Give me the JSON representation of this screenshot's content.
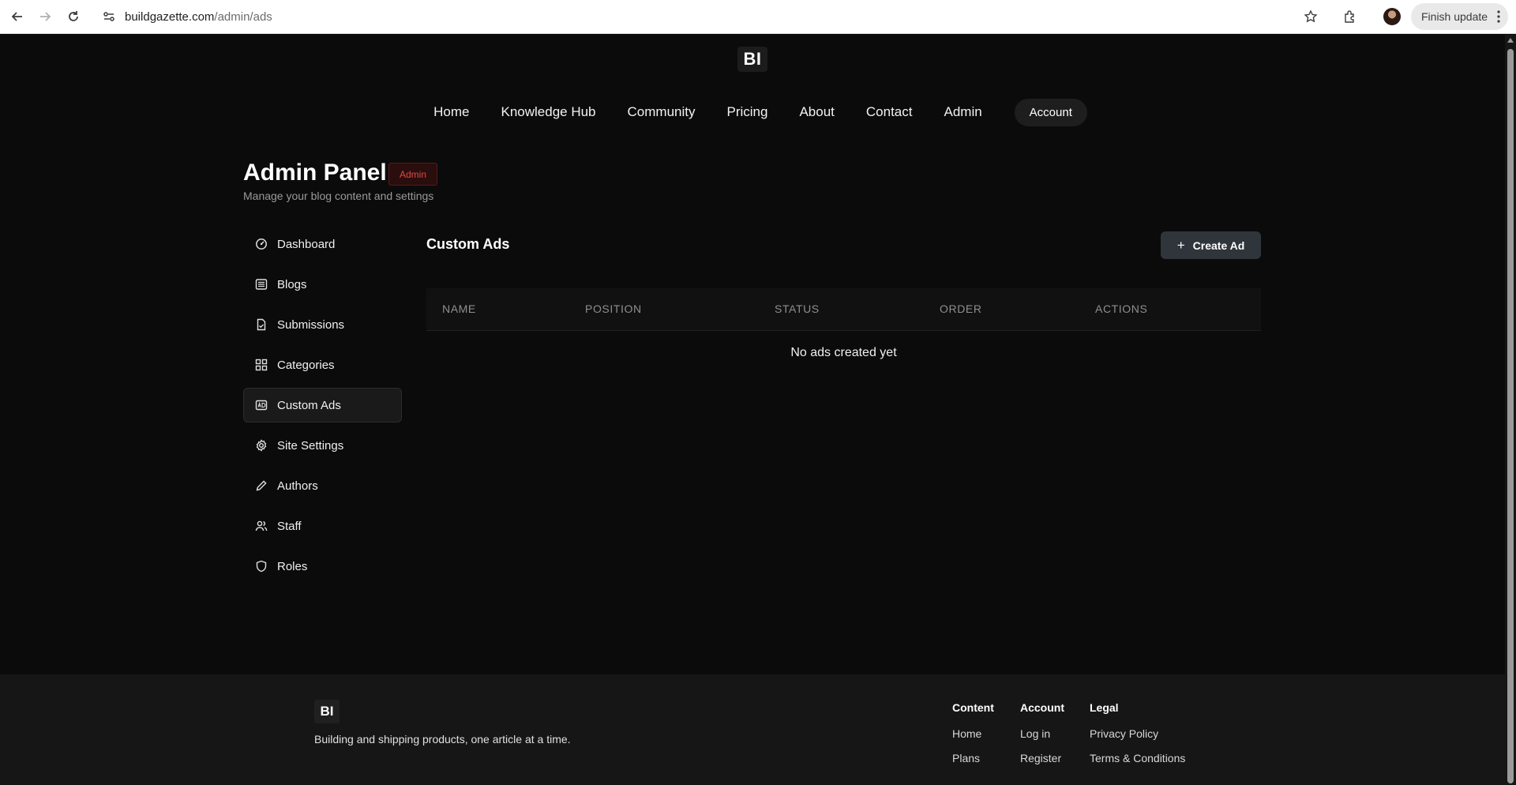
{
  "browser": {
    "url_host": "buildgazette.com",
    "url_path": "/admin/ads",
    "update_label": "Finish update"
  },
  "site": {
    "logo_text": "BI",
    "nav": [
      "Home",
      "Knowledge Hub",
      "Community",
      "Pricing",
      "About",
      "Contact",
      "Admin"
    ],
    "account_label": "Account"
  },
  "admin": {
    "title": "Admin Panel",
    "badge": "Admin",
    "subtitle": "Manage your blog content and settings"
  },
  "sidebar": {
    "items": [
      {
        "label": "Dashboard",
        "icon": "dashboard-icon",
        "active": false
      },
      {
        "label": "Blogs",
        "icon": "list-icon",
        "active": false
      },
      {
        "label": "Submissions",
        "icon": "document-check-icon",
        "active": false
      },
      {
        "label": "Categories",
        "icon": "grid-icon",
        "active": false
      },
      {
        "label": "Custom Ads",
        "icon": "ad-icon",
        "active": true
      },
      {
        "label": "Site Settings",
        "icon": "gear-icon",
        "active": false
      },
      {
        "label": "Authors",
        "icon": "pencil-icon",
        "active": false
      },
      {
        "label": "Staff",
        "icon": "users-icon",
        "active": false
      },
      {
        "label": "Roles",
        "icon": "shield-icon",
        "active": false
      }
    ]
  },
  "main": {
    "section_title": "Custom Ads",
    "create_label": "Create Ad",
    "columns": [
      "NAME",
      "POSITION",
      "STATUS",
      "ORDER",
      "ACTIONS"
    ],
    "empty_message": "No ads created yet"
  },
  "footer": {
    "logo_text": "BI",
    "tagline": "Building and shipping products, one article at a time.",
    "columns": [
      {
        "heading": "Content",
        "links": [
          "Home",
          "Plans"
        ]
      },
      {
        "heading": "Account",
        "links": [
          "Log in",
          "Register"
        ]
      },
      {
        "heading": "Legal",
        "links": [
          "Privacy Policy",
          "Terms & Conditions"
        ]
      }
    ]
  },
  "colors": {
    "background": "#0b0b0b",
    "badge_text": "#e04848",
    "button_bg": "#2f353b"
  }
}
